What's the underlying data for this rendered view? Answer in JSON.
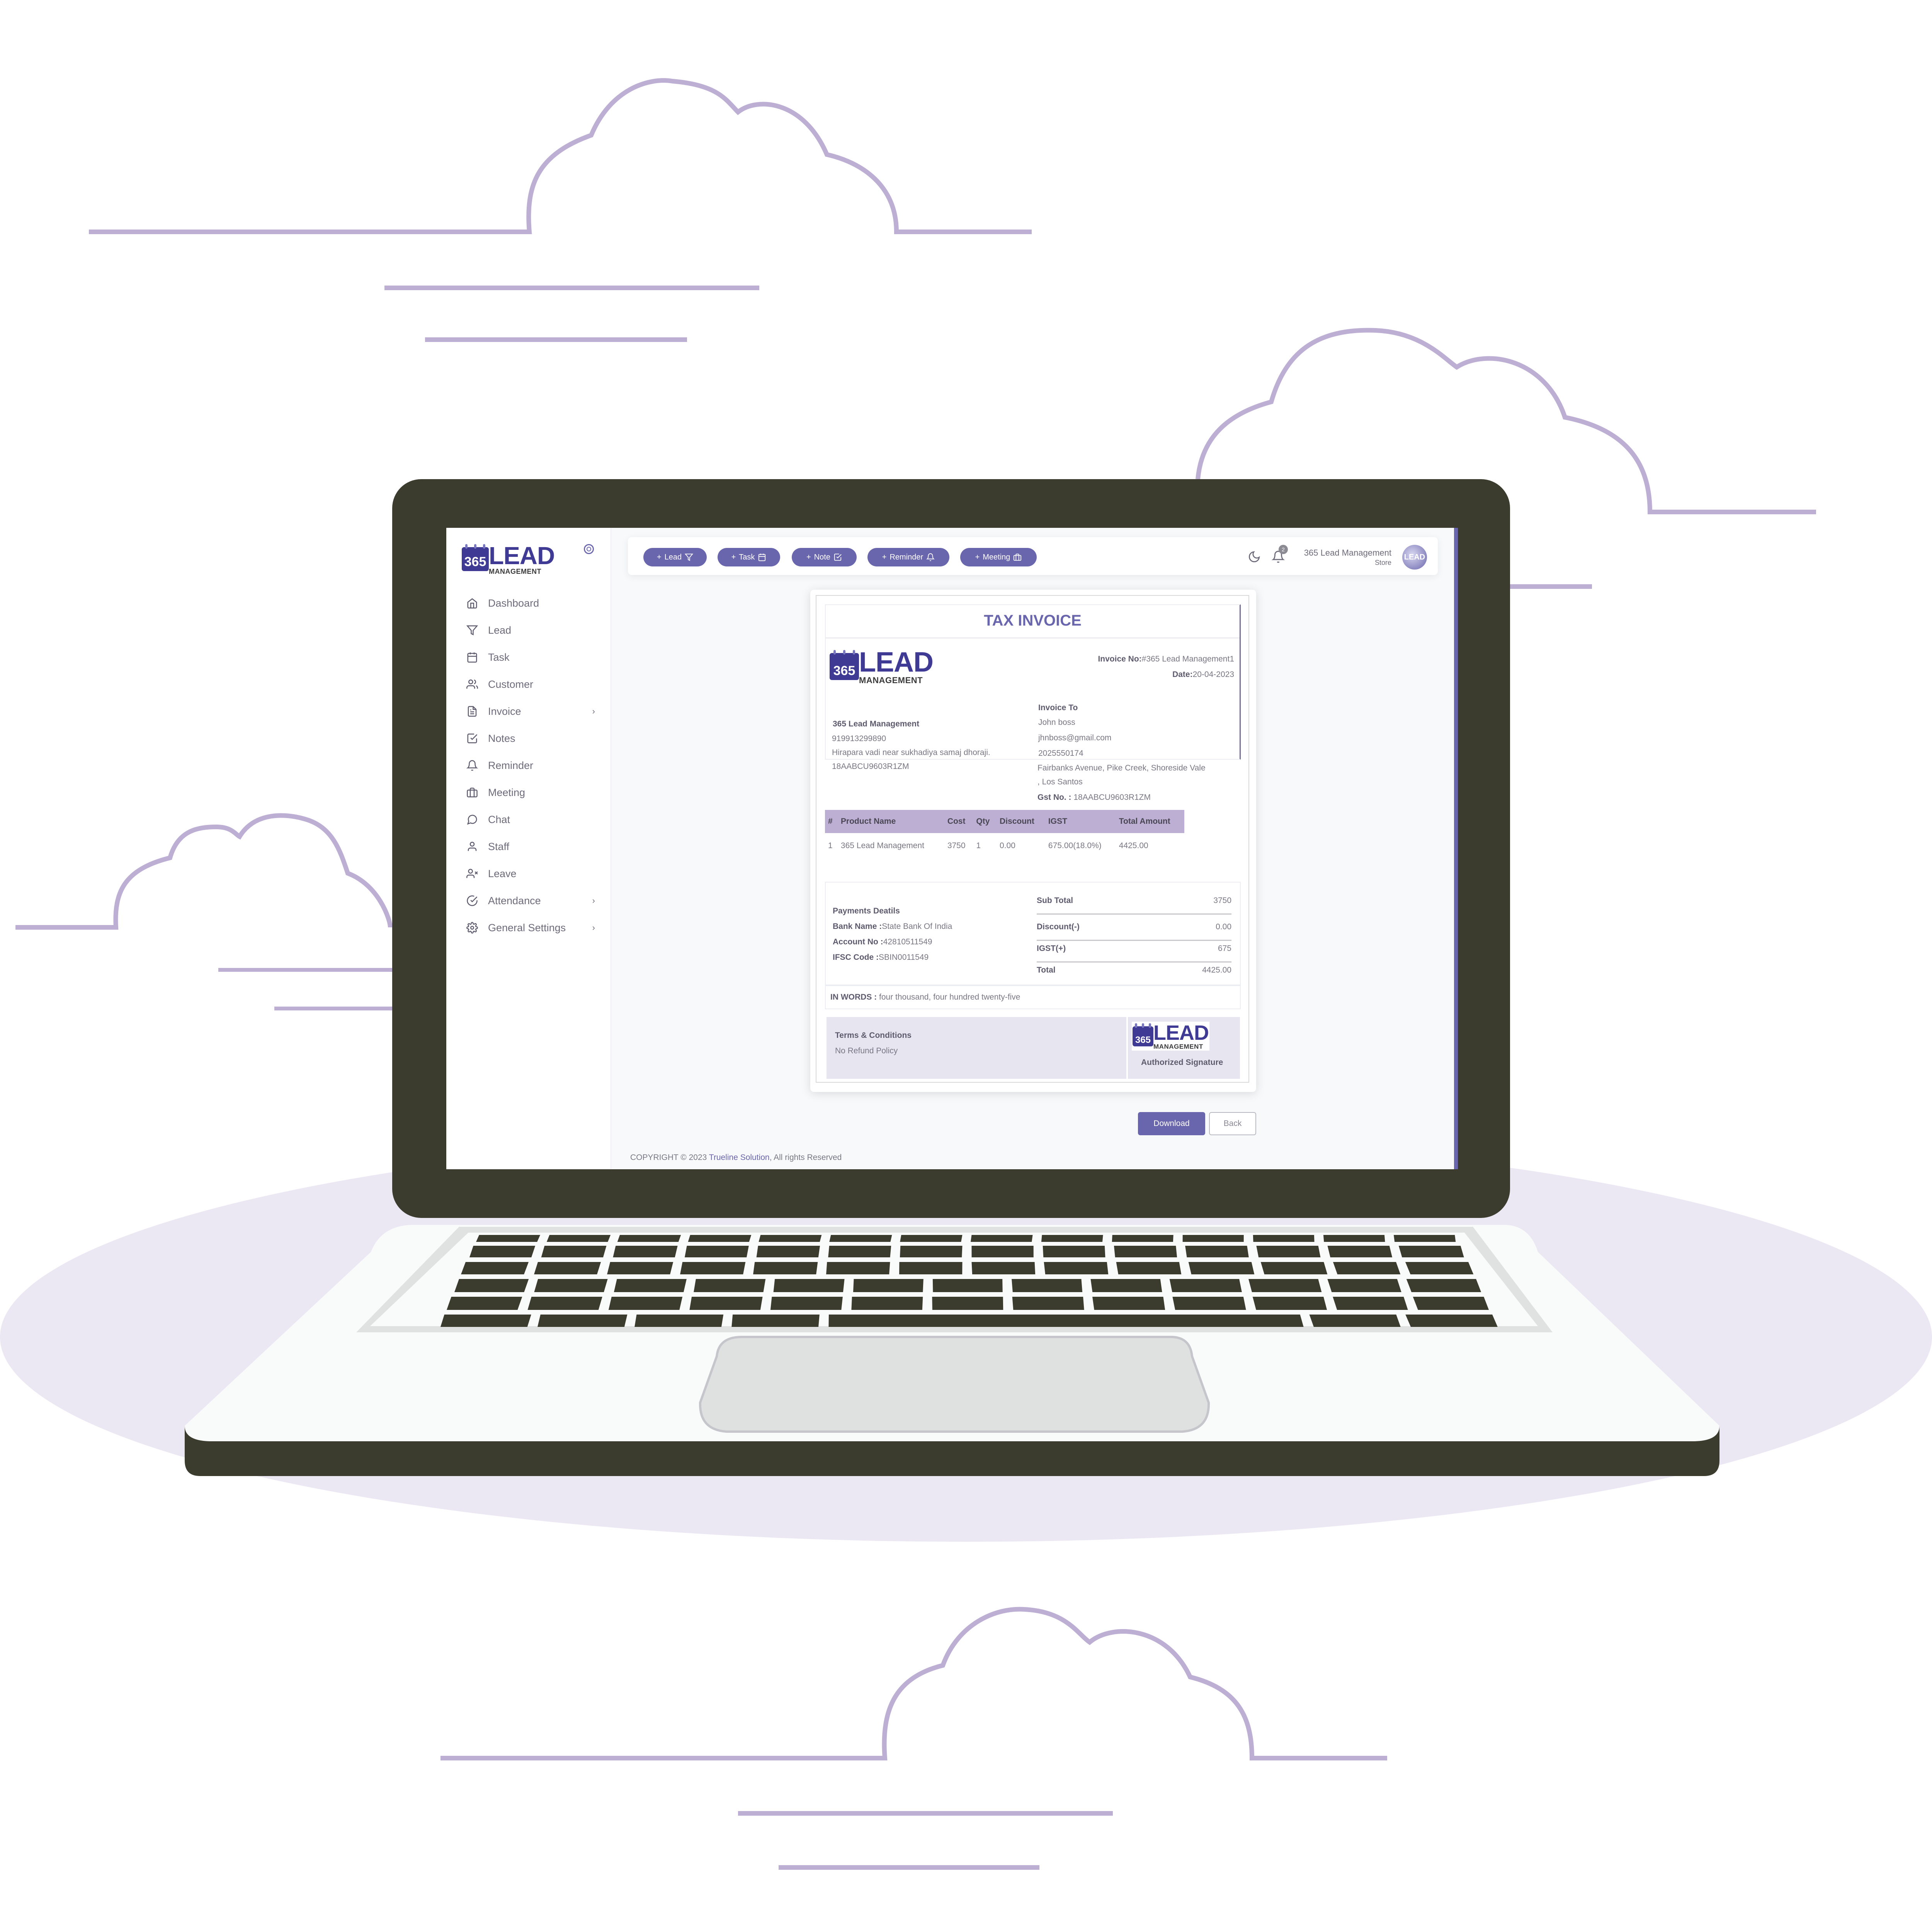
{
  "colors": {
    "accent": "#6a66ad",
    "cloud_stroke": "#bdaed4",
    "laptop_dark": "#3b3b2e",
    "laptop_body": "#f9fafa",
    "shadow_ellipse": "#ebe8f4",
    "table_header": "#bdaed4",
    "terms_bg": "#e7e5f0"
  },
  "brand": {
    "logo_number": "365",
    "logo_word": "LEAD",
    "logo_sub": "MANAGEMENT"
  },
  "sidebar": {
    "collapse_icon": "circle-toggle-icon",
    "items": [
      {
        "label": "Dashboard",
        "icon": "home-icon",
        "has_submenu": false
      },
      {
        "label": "Lead",
        "icon": "funnel-icon",
        "has_submenu": false
      },
      {
        "label": "Task",
        "icon": "calendar-icon",
        "has_submenu": false
      },
      {
        "label": "Customer",
        "icon": "users-icon",
        "has_submenu": false
      },
      {
        "label": "Invoice",
        "icon": "file-text-icon",
        "has_submenu": true
      },
      {
        "label": "Notes",
        "icon": "check-square-icon",
        "has_submenu": false
      },
      {
        "label": "Reminder",
        "icon": "bell-icon",
        "has_submenu": false
      },
      {
        "label": "Meeting",
        "icon": "briefcase-icon",
        "has_submenu": false
      },
      {
        "label": "Chat",
        "icon": "message-circle-icon",
        "has_submenu": false
      },
      {
        "label": "Staff",
        "icon": "user-icon",
        "has_submenu": false
      },
      {
        "label": "Leave",
        "icon": "user-x-icon",
        "has_submenu": false
      },
      {
        "label": "Attendance",
        "icon": "check-circle-icon",
        "has_submenu": true
      },
      {
        "label": "General Settings",
        "icon": "settings-icon",
        "has_submenu": true
      }
    ],
    "chevron": "›"
  },
  "topbar": {
    "quick_actions": [
      {
        "label": "Lead",
        "icon": "funnel-icon"
      },
      {
        "label": "Task",
        "icon": "calendar-icon"
      },
      {
        "label": "Note",
        "icon": "check-square-icon"
      },
      {
        "label": "Reminder",
        "icon": "bell-icon"
      },
      {
        "label": "Meeting",
        "icon": "briefcase-icon"
      }
    ],
    "plus": "+",
    "notification_count": "2",
    "user_name": "365 Lead Management",
    "user_role": "Store",
    "avatar_text": "LEAD"
  },
  "invoice": {
    "title": "TAX INVOICE",
    "invoice_no_label": "Invoice No:",
    "invoice_no": "#365 Lead Management1",
    "date_label": "Date:",
    "date": "20-04-2023",
    "from": {
      "name": "365 Lead Management",
      "phone": "919913299890",
      "address": "Hirapara vadi near sukhadiya samaj dhoraji.",
      "gst": "18AABCU9603R1ZM"
    },
    "to": {
      "heading": "Invoice To",
      "name": "John boss",
      "email": "jhnboss@gmail.com",
      "phone": "2025550174",
      "address_line1": "Fairbanks Avenue, Pike Creek, Shoreside Vale",
      "address_line2": ", Los Santos",
      "gst_label": "Gst No. :",
      "gst": "18AABCU9603R1ZM"
    },
    "table": {
      "headers": [
        "#",
        "Product Name",
        "Cost",
        "Qty",
        "Discount",
        "IGST",
        "Total Amount"
      ],
      "rows": [
        [
          "1",
          "365 Lead Management",
          "3750",
          "1",
          "0.00",
          "675.00(18.0%)",
          "4425.00"
        ]
      ]
    },
    "payment": {
      "heading": "Payments Deatils",
      "bank_label": "Bank Name :",
      "bank": "State Bank Of India",
      "account_label": "Account No :",
      "account": "42810511549",
      "ifsc_label": "IFSC Code :",
      "ifsc": "SBIN0011549"
    },
    "totals": [
      {
        "label": "Sub Total",
        "value": "3750"
      },
      {
        "label": "Discount(-)",
        "value": "0.00"
      },
      {
        "label": "IGST(+)",
        "value": "675"
      },
      {
        "label": "Total",
        "value": "4425.00"
      }
    ],
    "in_words_label": "IN WORDS :",
    "in_words": "four thousand, four hundred twenty-five",
    "terms_heading": "Terms & Conditions",
    "terms_text": "No Refund Policy",
    "signature_label": "Authorized Signature"
  },
  "actions": {
    "download": "Download",
    "back": "Back"
  },
  "footer": {
    "prefix": "COPYRIGHT © 2023 ",
    "company": "Trueline Solution",
    "suffix": ", All rights Reserved"
  }
}
